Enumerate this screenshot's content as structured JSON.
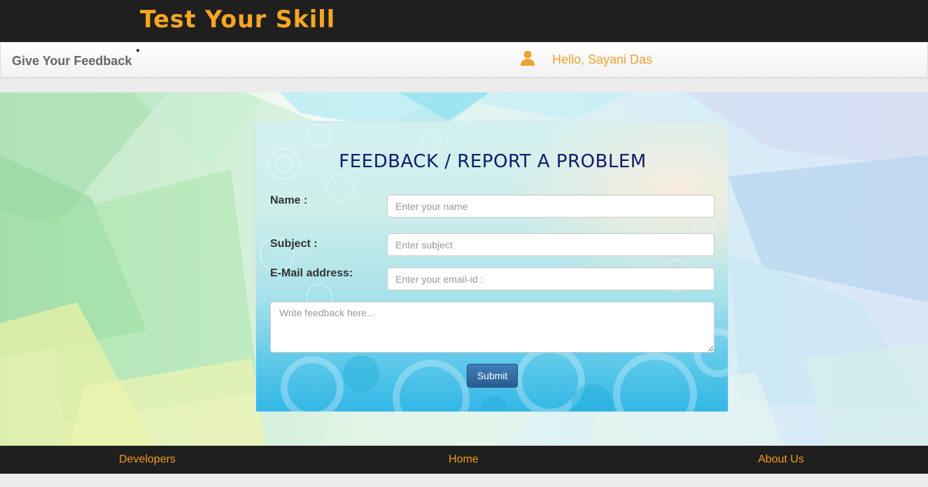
{
  "brand": {
    "title": "Test Your Skill",
    "color": "#f6a623"
  },
  "navbar": {
    "title": "Give Your Feedback",
    "greeting": "Hello, Sayani Das",
    "user_icon": "user-icon",
    "accent_color": "#f0a030"
  },
  "form": {
    "heading": "FEEDBACK / REPORT A PROBLEM",
    "name_label": "Name :",
    "name_placeholder": "Enter your name",
    "name_value": "",
    "subject_label": "Subject :",
    "subject_placeholder": "Enter subject",
    "subject_value": "",
    "email_label": "E-Mail address:",
    "email_placeholder": "Enter your email-id :",
    "email_value": "",
    "feedback_placeholder": "Write feedback here...",
    "feedback_value": "",
    "submit_label": "Submit"
  },
  "footer": {
    "links": [
      {
        "label": "Developers"
      },
      {
        "label": "Home"
      },
      {
        "label": "About Us"
      }
    ],
    "link_color": "#f39c12"
  }
}
